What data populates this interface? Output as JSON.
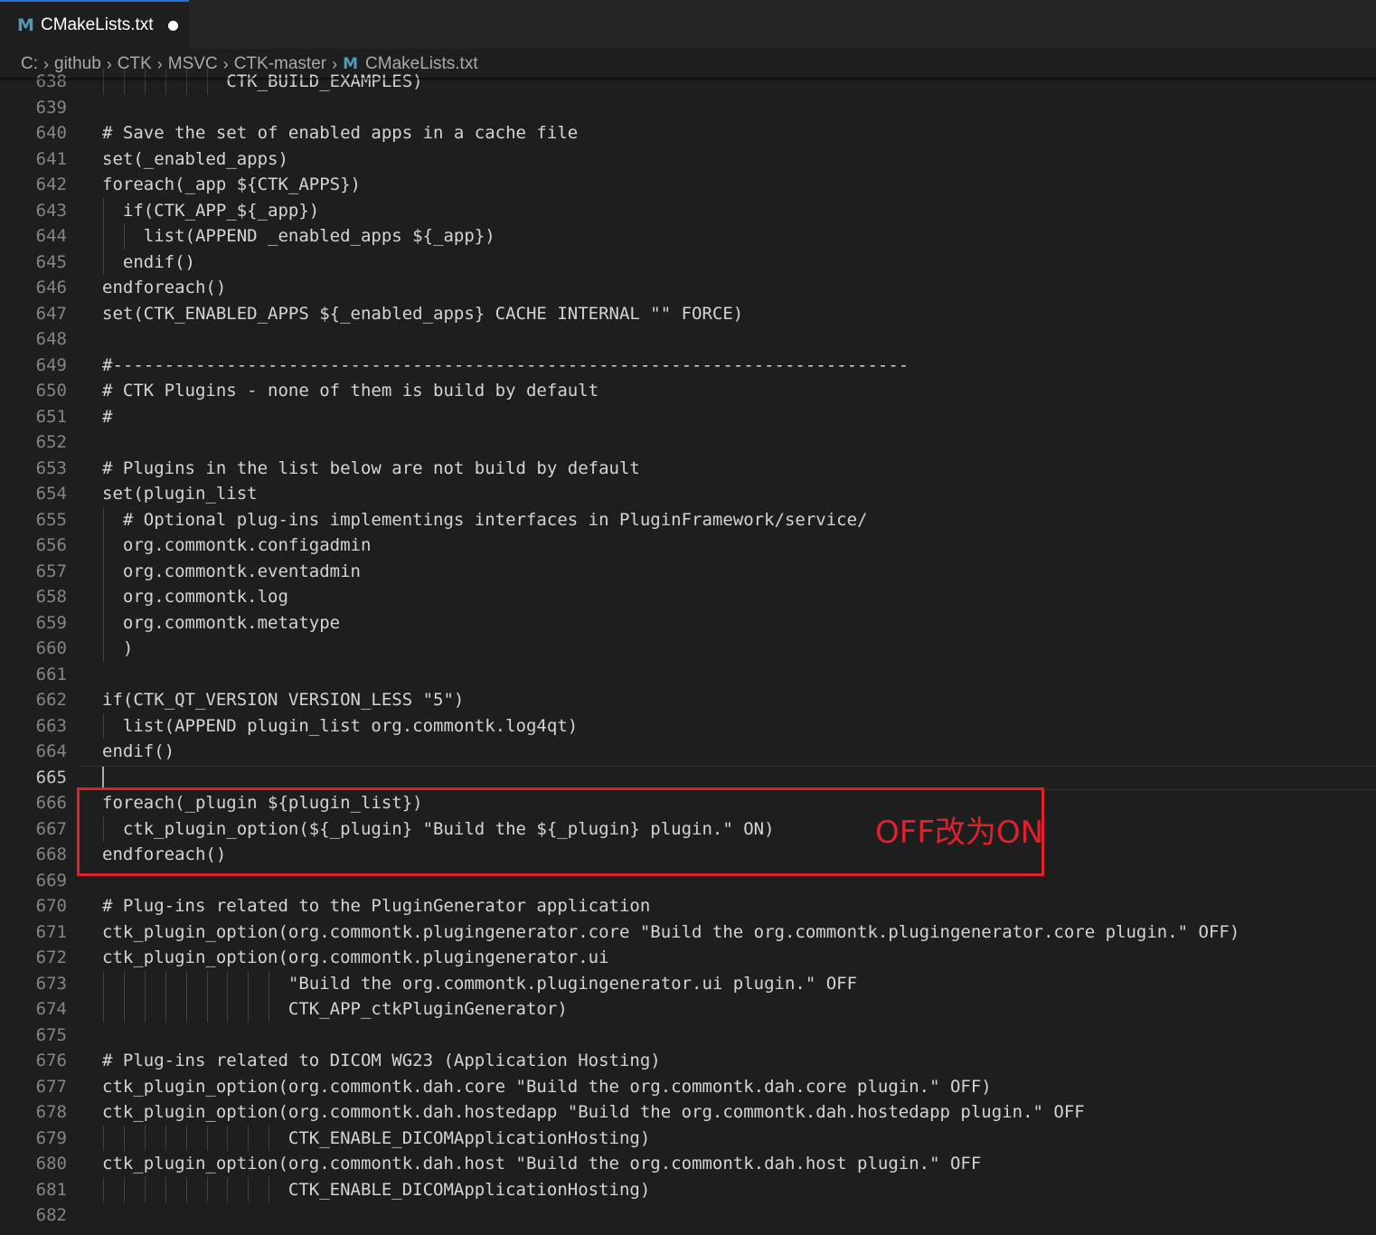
{
  "tab": {
    "icon": "cmake-m-icon",
    "title": "CMakeLists.txt"
  },
  "breadcrumb": {
    "items": [
      "C:",
      "github",
      "CTK",
      "MSVC",
      "CTK-master"
    ],
    "file": "CMakeLists.txt"
  },
  "editor": {
    "current_line": 665,
    "lines": [
      {
        "n": "638",
        "t": "            CTK_BUILD_EXAMPLES)"
      },
      {
        "n": "639",
        "t": ""
      },
      {
        "n": "640",
        "t": "# Save the set of enabled apps in a cache file"
      },
      {
        "n": "641",
        "t": "set(_enabled_apps)"
      },
      {
        "n": "642",
        "t": "foreach(_app ${CTK_APPS})"
      },
      {
        "n": "643",
        "t": "  if(CTK_APP_${_app})"
      },
      {
        "n": "644",
        "t": "    list(APPEND _enabled_apps ${_app})"
      },
      {
        "n": "645",
        "t": "  endif()"
      },
      {
        "n": "646",
        "t": "endforeach()"
      },
      {
        "n": "647",
        "t": "set(CTK_ENABLED_APPS ${_enabled_apps} CACHE INTERNAL \"\" FORCE)"
      },
      {
        "n": "648",
        "t": ""
      },
      {
        "n": "649",
        "t": "#-----------------------------------------------------------------------------"
      },
      {
        "n": "650",
        "t": "# CTK Plugins - none of them is build by default"
      },
      {
        "n": "651",
        "t": "#"
      },
      {
        "n": "652",
        "t": ""
      },
      {
        "n": "653",
        "t": "# Plugins in the list below are not build by default"
      },
      {
        "n": "654",
        "t": "set(plugin_list"
      },
      {
        "n": "655",
        "t": "  # Optional plug-ins implementings interfaces in PluginFramework/service/"
      },
      {
        "n": "656",
        "t": "  org.commontk.configadmin"
      },
      {
        "n": "657",
        "t": "  org.commontk.eventadmin"
      },
      {
        "n": "658",
        "t": "  org.commontk.log"
      },
      {
        "n": "659",
        "t": "  org.commontk.metatype"
      },
      {
        "n": "660",
        "t": "  )"
      },
      {
        "n": "661",
        "t": ""
      },
      {
        "n": "662",
        "t": "if(CTK_QT_VERSION VERSION_LESS \"5\")"
      },
      {
        "n": "663",
        "t": "  list(APPEND plugin_list org.commontk.log4qt)"
      },
      {
        "n": "664",
        "t": "endif()"
      },
      {
        "n": "665",
        "t": ""
      },
      {
        "n": "666",
        "t": "foreach(_plugin ${plugin_list})"
      },
      {
        "n": "667",
        "t": "  ctk_plugin_option(${_plugin} \"Build the ${_plugin} plugin.\" ON)"
      },
      {
        "n": "668",
        "t": "endforeach()"
      },
      {
        "n": "669",
        "t": ""
      },
      {
        "n": "670",
        "t": "# Plug-ins related to the PluginGenerator application"
      },
      {
        "n": "671",
        "t": "ctk_plugin_option(org.commontk.plugingenerator.core \"Build the org.commontk.plugingenerator.core plugin.\" OFF)"
      },
      {
        "n": "672",
        "t": "ctk_plugin_option(org.commontk.plugingenerator.ui"
      },
      {
        "n": "673",
        "t": "                  \"Build the org.commontk.plugingenerator.ui plugin.\" OFF"
      },
      {
        "n": "674",
        "t": "                  CTK_APP_ctkPluginGenerator)"
      },
      {
        "n": "675",
        "t": ""
      },
      {
        "n": "676",
        "t": "# Plug-ins related to DICOM WG23 (Application Hosting)"
      },
      {
        "n": "677",
        "t": "ctk_plugin_option(org.commontk.dah.core \"Build the org.commontk.dah.core plugin.\" OFF)"
      },
      {
        "n": "678",
        "t": "ctk_plugin_option(org.commontk.dah.hostedapp \"Build the org.commontk.dah.hostedapp plugin.\" OFF"
      },
      {
        "n": "679",
        "t": "                  CTK_ENABLE_DICOMApplicationHosting)"
      },
      {
        "n": "680",
        "t": "ctk_plugin_option(org.commontk.dah.host \"Build the org.commontk.dah.host plugin.\" OFF"
      },
      {
        "n": "681",
        "t": "                  CTK_ENABLE_DICOMApplicationHosting)"
      },
      {
        "n": "682",
        "t": ""
      }
    ]
  },
  "annotation": {
    "text": "OFF改为ON",
    "color": "#e0202a"
  }
}
